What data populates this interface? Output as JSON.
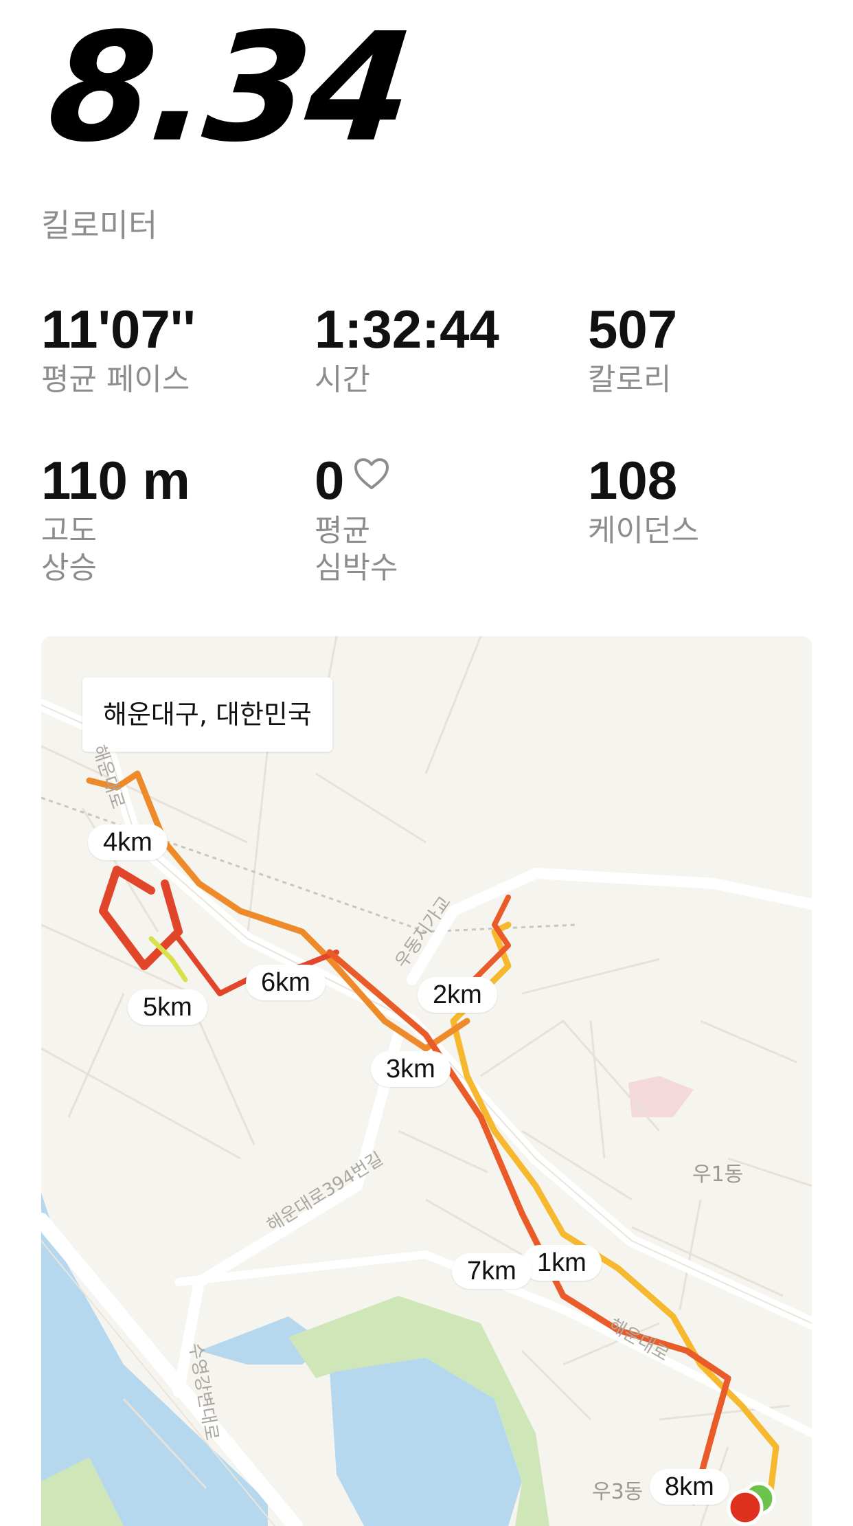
{
  "summary": {
    "distance": "8.34",
    "distance_unit": "킬로미터"
  },
  "stats": [
    {
      "value": "11'07''",
      "label": "평균 페이스"
    },
    {
      "value": "1:32:44",
      "label": "시간"
    },
    {
      "value": "507",
      "label": "칼로리"
    },
    {
      "value": "110 m",
      "label": "고도\n상승"
    },
    {
      "value": "0",
      "label": "평균\n심박수",
      "icon": "heart-outline-icon"
    },
    {
      "value": "108",
      "label": "케이던스"
    }
  ],
  "map": {
    "location": "해운대구, 대한민국",
    "km_markers": [
      "4km",
      "5km",
      "6km",
      "2km",
      "3km",
      "1km",
      "7km",
      "8km"
    ],
    "place_labels": [
      "우1동",
      "우3동"
    ],
    "road_labels": [
      "해운대로",
      "해운대로394번길",
      "우동지가교",
      "수영강변대로",
      "해운대로"
    ],
    "colors": {
      "map_background": "#f6f4ee",
      "water": "#b5d8ef",
      "park": "#cfe6b8",
      "route_fast": "#f5b82e",
      "route_mid": "#ee8a2a",
      "route_slow": "#e2462a",
      "start_marker": "#6cc24a",
      "end_marker": "#e0311f"
    }
  }
}
